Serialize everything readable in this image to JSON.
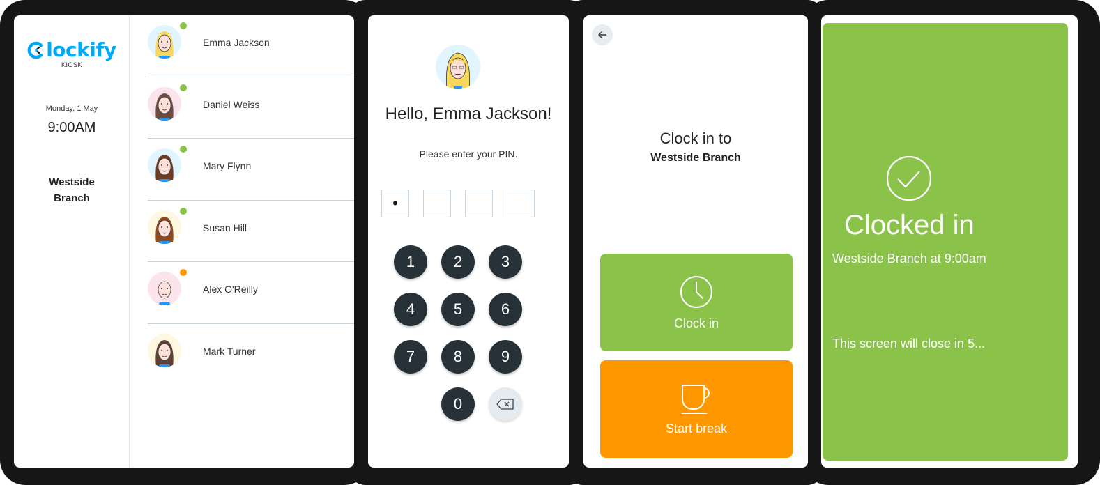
{
  "colors": {
    "brand": "#03a9f4",
    "green": "#8bc34a",
    "orange": "#ff9800",
    "keypad": "#263238",
    "status_active": "#8bc34a",
    "status_break": "#ff9800"
  },
  "kiosk": {
    "logo_text": "lockify",
    "logo_sub": "KIOSK",
    "date": "Monday, 1 May",
    "time": "9:00AM",
    "branch_line1": "Westside",
    "branch_line2": "Branch",
    "users": [
      {
        "name": "Emma Jackson",
        "status": "active",
        "avatar_bg": "#e1f5fe"
      },
      {
        "name": "Daniel Weiss",
        "status": "active",
        "avatar_bg": "#fce4ec"
      },
      {
        "name": "Mary Flynn",
        "status": "active",
        "avatar_bg": "#e1f5fe"
      },
      {
        "name": "Susan Hill",
        "status": "active",
        "avatar_bg": "#fff8e1"
      },
      {
        "name": "Alex O'Reilly",
        "status": "on-break",
        "avatar_bg": "#fce4ec"
      },
      {
        "name": "Mark Turner",
        "status": "none",
        "avatar_bg": "#fff8e1"
      }
    ]
  },
  "pin": {
    "greeting": "Hello, Emma Jackson!",
    "prompt": "Please enter your PIN.",
    "digits": [
      "•",
      "",
      "",
      ""
    ],
    "keys": [
      "1",
      "2",
      "3",
      "4",
      "5",
      "6",
      "7",
      "8",
      "9",
      "0"
    ],
    "backspace_icon": "backspace-icon"
  },
  "clock": {
    "back_icon": "arrow-left-icon",
    "title": "Clock in to",
    "branch": "Westside Branch",
    "clock_in_label": "Clock in",
    "clock_in_icon": "clock-icon",
    "break_label": "Start break",
    "break_icon": "coffee-cup-icon"
  },
  "success": {
    "icon": "check-circle-icon",
    "title": "Clocked in",
    "subtitle": "Westside Branch at 9:00am",
    "close_note": "This screen will close in 5..."
  }
}
